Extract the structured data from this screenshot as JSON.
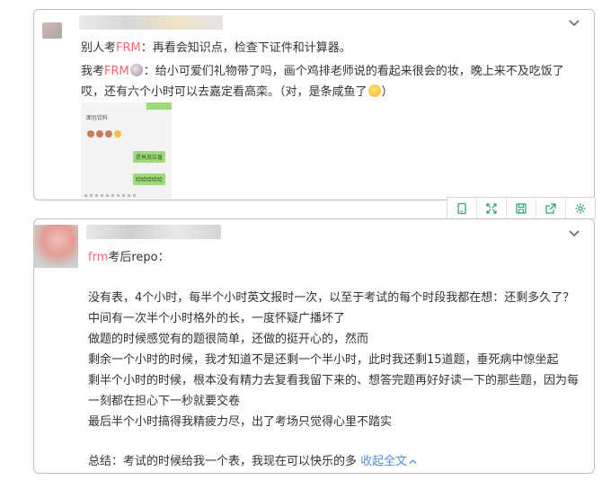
{
  "card1": {
    "comment_a": {
      "prefix": "别人考",
      "tag": "FRM",
      "text": "：再看会知识点，检查下证件和计算器。"
    },
    "comment_b": {
      "prefix": "我考",
      "tag": "FRM",
      "line1": "：给小可爱们礼物带了吗，画个鸡排老师说的看起来很会的妆，晚上来不及吃饭了",
      "line2": "哎，还有六个小时可以去嘉定看高栾。（对，是条咸鱼了",
      "line2_end": "）"
    },
    "chat_image": {
      "caption": "面包饮料",
      "bubble1": "是再放应援",
      "bubble2": "哈哈哈哈哈"
    }
  },
  "toolbar": {
    "items": [
      "copy-icon",
      "expand-icon",
      "save-icon",
      "share-icon",
      "settings-icon"
    ]
  },
  "card2": {
    "title_tag": "frm",
    "title_rest": "考后repo：",
    "lines": [
      "没有表，4个小时，每半个小时英文报时一次，以至于考试的每个时段我都在想：还剩多久了？",
      "中间有一次半个小时格外的长，一度怀疑广播坏了",
      "做题的时候感觉有的题很简单，还做的挺开心的，然而",
      "剩余一个小时的时候，我才知道不是还剩一个半小时，此时我还剩15道题，垂死病中惊坐起",
      "剩半个小时的时候，根本没有精力去复看我留下来的、想答完题再好好读一下的那些题，因为每",
      "一刻都在担心下一秒就要交卷",
      "最后半个小时搞得我精疲力尽，出了考场只觉得心里不踏实"
    ],
    "summary": "总结：考试的时候给我一个表，我现在可以快乐的多",
    "collapse_label": "收起全文"
  },
  "colors": {
    "tag": "#ef6a6a",
    "link": "#4e8fd8",
    "border": "#bdbdbd",
    "chat_green": "#9ed97a"
  }
}
